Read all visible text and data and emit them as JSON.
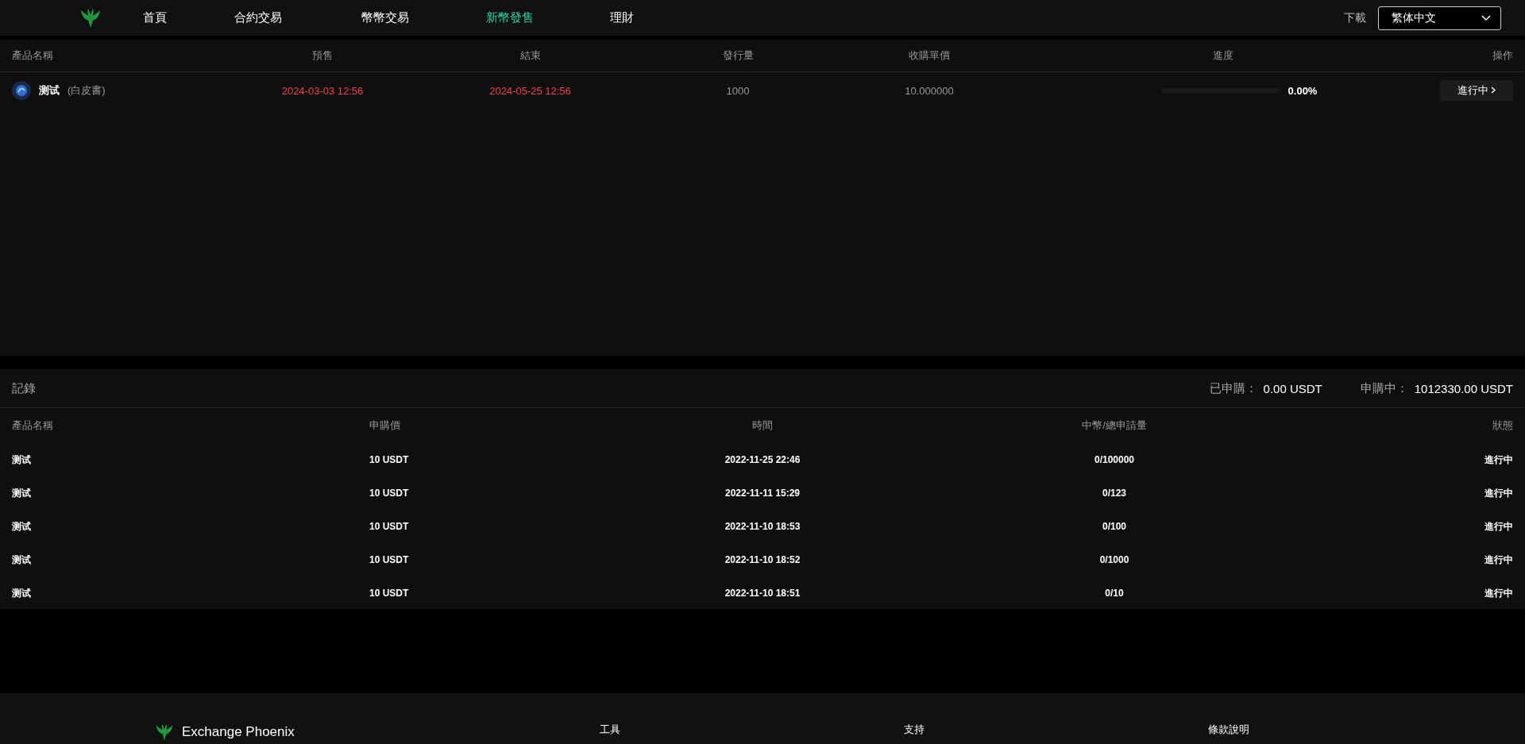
{
  "nav": {
    "items": [
      {
        "label": "首頁",
        "selected": false
      },
      {
        "label": "合約交易",
        "selected": false
      },
      {
        "label": "幣幣交易",
        "selected": false
      },
      {
        "label": "新幣發售",
        "selected": true
      },
      {
        "label": "理財",
        "selected": false
      }
    ],
    "download": "下載",
    "language": "繁体中文"
  },
  "products": {
    "columns": [
      "產品名稱",
      "預售",
      "結束",
      "發行量",
      "收購單價",
      "進度",
      "操作"
    ],
    "rows": [
      {
        "name": "测试",
        "whitepaper": "(白皮書)",
        "presale": "2024-03-03 12:56",
        "end": "2024-05-25 12:56",
        "supply": "1000",
        "price": "10.000000",
        "level": 0,
        "progress": "0.00%",
        "action": "進行中"
      }
    ]
  },
  "records": {
    "title": "記錄",
    "subscribed_label": "已申購：",
    "subscribed": "0.00 USDT",
    "pending_label": "申購中：",
    "pending": "1012330.00 USDT",
    "columns": [
      "產品名稱",
      "申購價",
      "時間",
      "中幣/總申請量",
      "狀態"
    ],
    "rows": [
      {
        "name": "测试",
        "price": "10 USDT",
        "time": "2022-11-25 22:46",
        "ratio": "0/100000",
        "status": "進行中"
      },
      {
        "name": "测试",
        "price": "10 USDT",
        "time": "2022-11-11 15:29",
        "ratio": "0/123",
        "status": "進行中"
      },
      {
        "name": "测试",
        "price": "10 USDT",
        "time": "2022-11-10 18:53",
        "ratio": "0/100",
        "status": "進行中"
      },
      {
        "name": "测试",
        "price": "10 USDT",
        "time": "2022-11-10 18:52",
        "ratio": "0/1000",
        "status": "進行中"
      },
      {
        "name": "测试",
        "price": "10 USDT",
        "time": "2022-11-10 18:51",
        "ratio": "0/10",
        "status": "進行中"
      }
    ]
  },
  "footer": {
    "brand": "Exchange Phoenix",
    "columns": [
      "工具",
      "支持",
      "條款說明"
    ]
  }
}
